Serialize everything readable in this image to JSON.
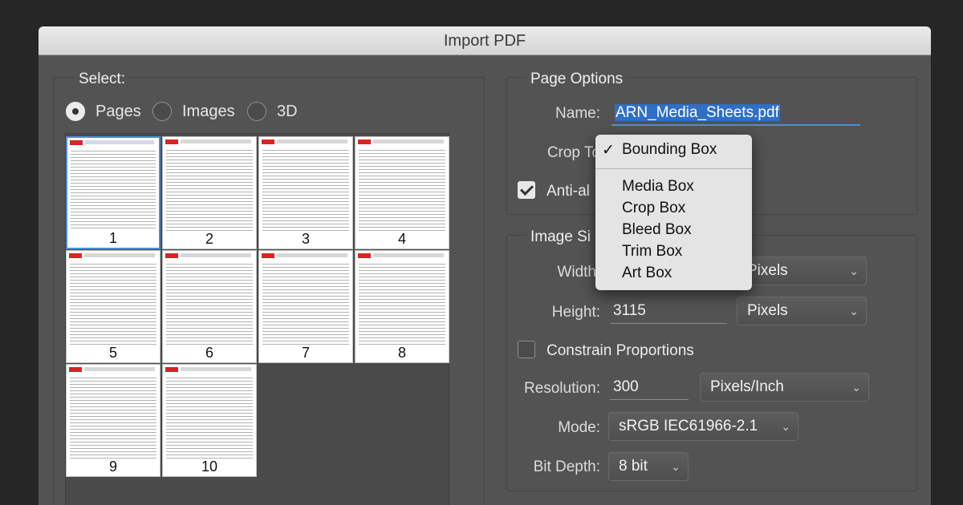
{
  "window": {
    "title": "Import PDF"
  },
  "select": {
    "title": "Select:",
    "options": [
      {
        "label": "Pages",
        "selected": true
      },
      {
        "label": "Images",
        "selected": false
      },
      {
        "label": "3D",
        "selected": false
      }
    ],
    "pages": [
      "1",
      "2",
      "3",
      "4",
      "5",
      "6",
      "7",
      "8",
      "9",
      "10"
    ],
    "selected_page": "1"
  },
  "page_options": {
    "title": "Page Options",
    "name_label": "Name:",
    "name_value": "ARN_Media_Sheets.pdf",
    "crop_label": "Crop To",
    "anti_alias_label": "Anti-al",
    "anti_alias_checked": true
  },
  "crop_menu": {
    "selected": "Bounding Box",
    "items": [
      "Media Box",
      "Crop Box",
      "Bleed Box",
      "Trim Box",
      "Art Box"
    ]
  },
  "image_size": {
    "title": "Image Si",
    "width_label": "Width",
    "width_unit": "Pixels",
    "height_label": "Height:",
    "height_value": "3115",
    "height_unit": "Pixels",
    "constrain_label": "Constrain Proportions",
    "constrain_checked": false,
    "resolution_label": "Resolution:",
    "resolution_value": "300",
    "resolution_unit": "Pixels/Inch",
    "mode_label": "Mode:",
    "mode_value": "sRGB IEC61966-2.1",
    "bitdepth_label": "Bit Depth:",
    "bitdepth_value": "8 bit"
  },
  "icons": {
    "chevron": "chevron-updown-icon",
    "check": "checkmark-icon"
  },
  "colors": {
    "accent": "#4a8fd8",
    "panel": "#535353",
    "menu": "#e4e4e4"
  }
}
